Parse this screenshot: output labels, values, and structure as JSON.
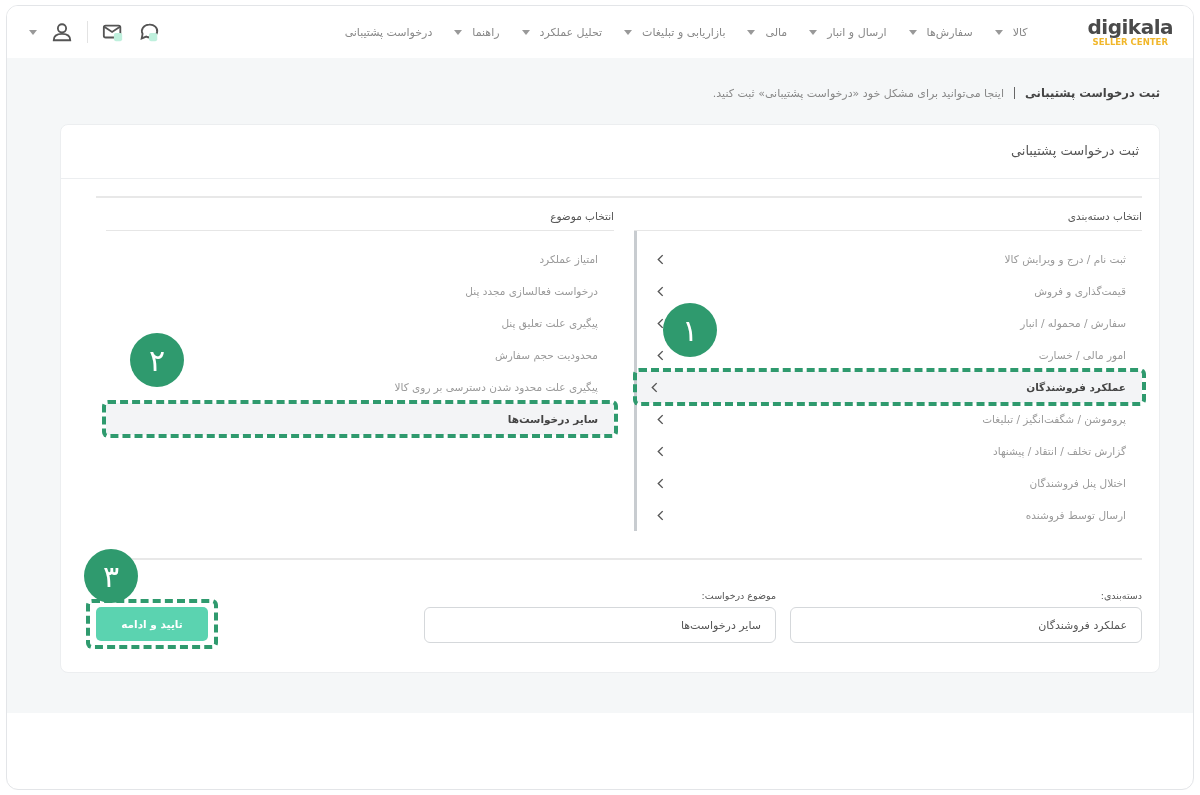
{
  "logo": {
    "name": "digikala",
    "subtitle": "SELLER CENTER"
  },
  "nav": [
    {
      "label": "کالا",
      "dropdown": true
    },
    {
      "label": "سفارش‌ها",
      "dropdown": true
    },
    {
      "label": "ارسال و انبار",
      "dropdown": true
    },
    {
      "label": "مالی",
      "dropdown": true
    },
    {
      "label": "بازاریابی و تبلیغات",
      "dropdown": true
    },
    {
      "label": "تحلیل عملکرد",
      "dropdown": true
    },
    {
      "label": "راهنما",
      "dropdown": true
    },
    {
      "label": "درخواست پشتیبانی",
      "dropdown": false
    }
  ],
  "page_header": {
    "title": "ثبت درخواست پشتیبانی",
    "subtitle": "اینجا می‌توانید برای مشکل خود «درخواست پشتیبانی» ثبت کنید."
  },
  "card": {
    "title": "ثبت درخواست پشتیبانی"
  },
  "categories": {
    "heading": "انتخاب دسته‌بندی",
    "items": [
      {
        "label": "ثبت نام / درج و ویرایش کالا",
        "selected": false
      },
      {
        "label": "قیمت‌گذاری و فروش",
        "selected": false
      },
      {
        "label": "سفارش / محموله / انبار",
        "selected": false
      },
      {
        "label": "امور مالی / خسارت",
        "selected": false
      },
      {
        "label": "عملکرد فروشندگان",
        "selected": true,
        "callout": "۱"
      },
      {
        "label": "پروموشن / شگفت‌انگیز / تبلیغات",
        "selected": false
      },
      {
        "label": "گزارش تخلف / انتقاد / پیشنهاد",
        "selected": false
      },
      {
        "label": "اختلال پنل فروشندگان",
        "selected": false
      },
      {
        "label": "ارسال توسط فروشنده",
        "selected": false
      }
    ]
  },
  "topics": {
    "heading": "انتخاب موضوع",
    "items": [
      {
        "label": "امتیاز عملکرد",
        "selected": false
      },
      {
        "label": "درخواست فعالسازی مجدد پنل",
        "selected": false
      },
      {
        "label": "پیگیری علت تعلیق پنل",
        "selected": false
      },
      {
        "label": "محدودیت حجم سفارش",
        "selected": false
      },
      {
        "label": "پیگیری علت محدود شدن دسترسی بر روی کالا",
        "selected": false
      },
      {
        "label": "سایر درخواست‌ها",
        "selected": true,
        "callout": "۲"
      }
    ]
  },
  "form": {
    "fields": [
      {
        "label": "دسته‌بندی:",
        "value": "عملکرد فروشندگان"
      },
      {
        "label": "موضوع درخواست:",
        "value": "سایر درخواست‌ها"
      }
    ],
    "submit": {
      "label": "تایید و ادامه",
      "callout": "۳"
    }
  }
}
